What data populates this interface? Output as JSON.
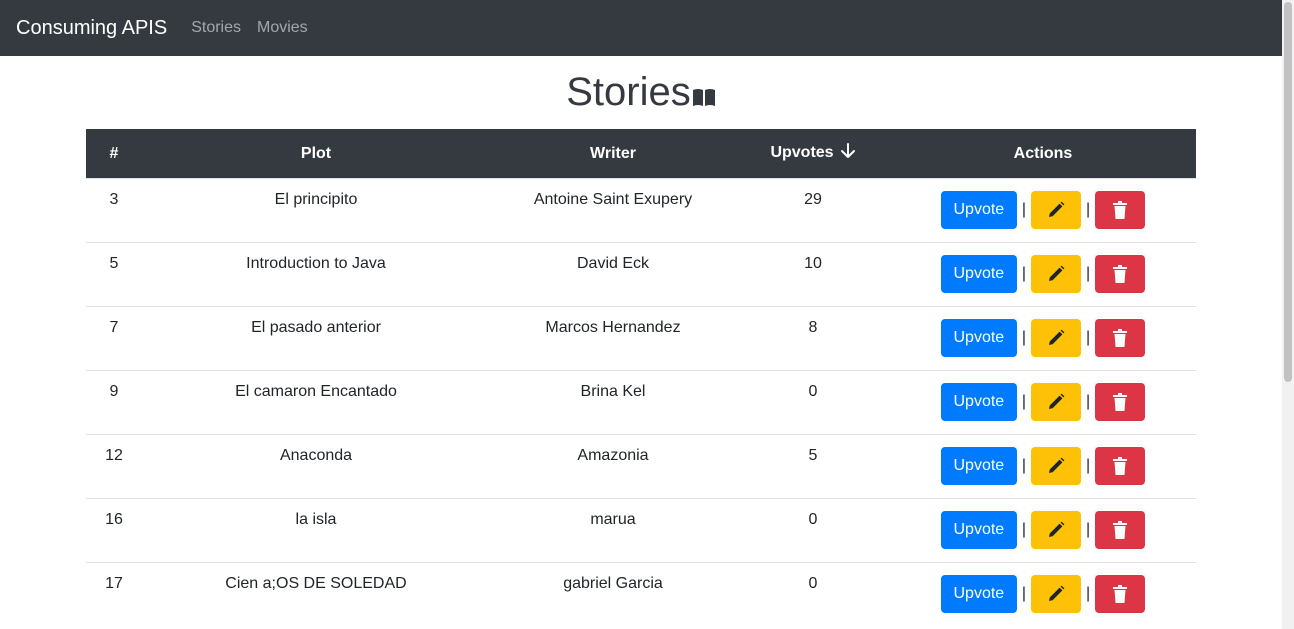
{
  "navbar": {
    "brand": "Consuming APIS",
    "links": [
      "Stories",
      "Movies"
    ]
  },
  "page": {
    "title": "Stories",
    "title_icon": "book-open-icon"
  },
  "table": {
    "headers": [
      "#",
      "Plot",
      "Writer",
      "Upvotes",
      "Actions"
    ],
    "sort_icon": "arrow-down-icon",
    "separator": "|",
    "rows": [
      {
        "id": "3",
        "plot": "El principito",
        "writer": "Antoine Saint Exupery",
        "upvotes": "29",
        "upvote_label": "Upvote"
      },
      {
        "id": "5",
        "plot": "Introduction to Java",
        "writer": "David Eck",
        "upvotes": "10",
        "upvote_label": "Upvote"
      },
      {
        "id": "7",
        "plot": "El pasado anterior",
        "writer": "Marcos Hernandez",
        "upvotes": "8",
        "upvote_label": "Upvote"
      },
      {
        "id": "9",
        "plot": "El camaron Encantado",
        "writer": "Brina Kel",
        "upvotes": "0",
        "upvote_label": "Upvote"
      },
      {
        "id": "12",
        "plot": "Anaconda",
        "writer": "Amazonia",
        "upvotes": "5",
        "upvote_label": "Upvote"
      },
      {
        "id": "16",
        "plot": "la isla",
        "writer": "marua",
        "upvotes": "0",
        "upvote_label": "Upvote"
      },
      {
        "id": "17",
        "plot": "Cien a;OS DE SOLEDAD",
        "writer": "gabriel Garcia",
        "upvotes": "0",
        "upvote_label": "Upvote"
      }
    ]
  },
  "colors": {
    "navbar": "#343a40",
    "primary": "#007bff",
    "warning": "#ffc107",
    "danger": "#dc3545"
  },
  "icons": {
    "edit": "pencil-icon",
    "delete": "trash-icon"
  }
}
